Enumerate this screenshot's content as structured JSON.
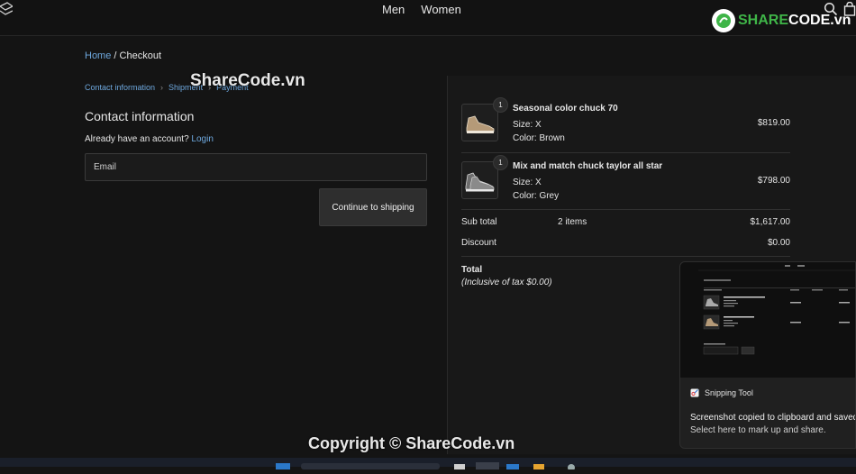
{
  "nav": {
    "links": [
      "Men",
      "Women"
    ]
  },
  "watermark": {
    "brand": "SHARECODE.vn",
    "brand_prefix": "SHARE",
    "brand_suffix": "CODE.vn",
    "top_text": "ShareCode.vn",
    "copyright": "Copyright © ShareCode.vn"
  },
  "breadcrumb": {
    "home": "Home",
    "sep": "/",
    "current": "Checkout"
  },
  "steps": [
    "Contact information",
    "Shipment",
    "Payment"
  ],
  "contact": {
    "title": "Contact information",
    "account_text": "Already have an account?",
    "login": "Login",
    "email_placeholder": "Email",
    "continue": "Continue to shipping"
  },
  "cart": {
    "items": [
      {
        "qty": "1",
        "name": "Seasonal color chuck 70",
        "size": "Size: X",
        "color": "Color: Brown",
        "price": "$819.00"
      },
      {
        "qty": "1",
        "name": "Mix and match chuck taylor all star",
        "size": "Size: X",
        "color": "Color: Grey",
        "price": "$798.00"
      }
    ],
    "subtotal_label": "Sub total",
    "subtotal_items": "2 items",
    "subtotal_value": "$1,617.00",
    "discount_label": "Discount",
    "discount_value": "$0.00",
    "total_label": "Total",
    "tax_note": "(Inclusive of tax $0.00)"
  },
  "toast": {
    "app": "Snipping Tool",
    "message": "Screenshot copied to clipboard and saved",
    "hint": "Select here to mark up and share."
  }
}
